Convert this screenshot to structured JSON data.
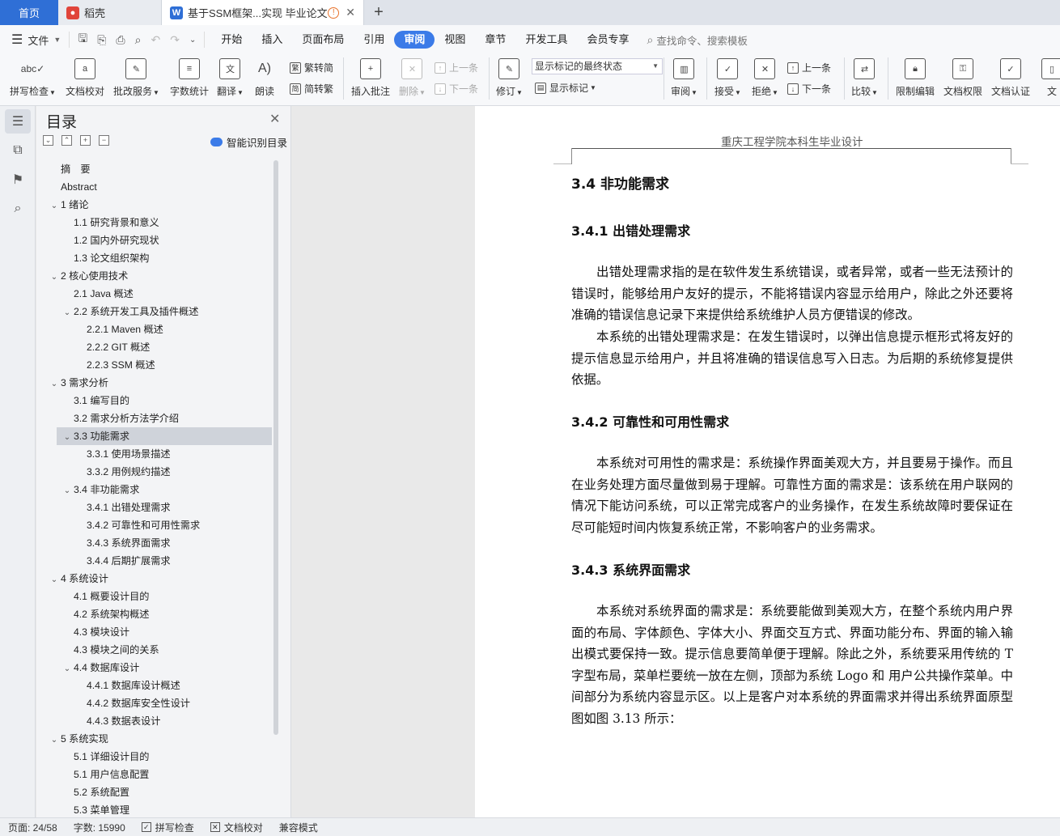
{
  "tabs": {
    "home": "首页",
    "daoke": "稻壳",
    "document": "基于SSM框架...实现 毕业论文"
  },
  "menu": {
    "file": "文件",
    "items": [
      "开始",
      "插入",
      "页面布局",
      "引用",
      "审阅",
      "视图",
      "章节",
      "开发工具",
      "会员专享"
    ],
    "active": "审阅",
    "search_placeholder": "查找命令、搜索模板"
  },
  "ribbon": {
    "spell_check": "拼写检查",
    "doc_proof": "文档校对",
    "annot_service": "批改服务",
    "word_count": "字数统计",
    "translate": "翻译",
    "read_aloud": "朗读",
    "to_traditional": "繁转简",
    "to_simplified": "简转繁",
    "insert_comment": "插入批注",
    "delete": "删除",
    "prev_comment": "上一条",
    "next_comment": "下一条",
    "track_changes": "修订",
    "markup_state": "显示标记的最终状态",
    "show_markup": "显示标记",
    "review": "审阅",
    "accept": "接受",
    "reject": "拒绝",
    "prev_change": "上一条",
    "next_change": "下一条",
    "compare": "比较",
    "restrict_edit": "限制编辑",
    "doc_rights": "文档权限",
    "doc_cert": "文档认证",
    "more": "文"
  },
  "nav": {
    "title": "目录",
    "smart_toc": "智能识别目录",
    "selected_index": 15,
    "toc": [
      {
        "level": 0,
        "text": "摘　要",
        "toggle": ""
      },
      {
        "level": 0,
        "text": "Abstract",
        "toggle": ""
      },
      {
        "level": 0,
        "text": "1  绪论",
        "toggle": "v"
      },
      {
        "level": 1,
        "text": "1.1  研究背景和意义",
        "toggle": ""
      },
      {
        "level": 1,
        "text": "1.2  国内外研究现状",
        "toggle": ""
      },
      {
        "level": 1,
        "text": "1.3  论文组织架构",
        "toggle": ""
      },
      {
        "level": 0,
        "text": "2  核心使用技术",
        "toggle": "v"
      },
      {
        "level": 1,
        "text": "2.1 Java 概述",
        "toggle": ""
      },
      {
        "level": 1,
        "text": "2.2 系统开发工具及插件概述",
        "toggle": "v"
      },
      {
        "level": 2,
        "text": "2.2.1 Maven  概述",
        "toggle": ""
      },
      {
        "level": 2,
        "text": "2.2.2 GIT 概述",
        "toggle": ""
      },
      {
        "level": 2,
        "text": "2.2.3 SSM 概述",
        "toggle": ""
      },
      {
        "level": 0,
        "text": "3  需求分析",
        "toggle": "v"
      },
      {
        "level": 1,
        "text": "3.1  编写目的",
        "toggle": ""
      },
      {
        "level": 1,
        "text": "3.2  需求分析方法学介绍",
        "toggle": ""
      },
      {
        "level": 1,
        "text": "3.3 功能需求",
        "toggle": "v"
      },
      {
        "level": 2,
        "text": "3.3.1 使用场景描述",
        "toggle": ""
      },
      {
        "level": 2,
        "text": "3.3.2 用例规约描述",
        "toggle": ""
      },
      {
        "level": 1,
        "text": "3.4  非功能需求",
        "toggle": "v"
      },
      {
        "level": 2,
        "text": "3.4.1  出错处理需求",
        "toggle": ""
      },
      {
        "level": 2,
        "text": "3.4.2  可靠性和可用性需求",
        "toggle": ""
      },
      {
        "level": 2,
        "text": "3.4.3  系统界面需求",
        "toggle": ""
      },
      {
        "level": 2,
        "text": "3.4.4  后期扩展需求",
        "toggle": ""
      },
      {
        "level": 0,
        "text": "4  系统设计",
        "toggle": "v"
      },
      {
        "level": 1,
        "text": "4.1  概要设计目的",
        "toggle": ""
      },
      {
        "level": 1,
        "text": "4.2  系统架构概述",
        "toggle": ""
      },
      {
        "level": 1,
        "text": "4.3  模块设计",
        "toggle": ""
      },
      {
        "level": 1,
        "text": "4.3  模块之间的关系",
        "toggle": ""
      },
      {
        "level": 1,
        "text": "4.4  数据库设计",
        "toggle": "v"
      },
      {
        "level": 2,
        "text": "4.4.1  数据库设计概述",
        "toggle": ""
      },
      {
        "level": 2,
        "text": "4.4.2  数据库安全性设计",
        "toggle": ""
      },
      {
        "level": 2,
        "text": "4.4.3 数据表设计",
        "toggle": ""
      },
      {
        "level": 0,
        "text": "5  系统实现",
        "toggle": "v"
      },
      {
        "level": 1,
        "text": "5.1  详细设计目的",
        "toggle": ""
      },
      {
        "level": 1,
        "text": "5.1  用户信息配置",
        "toggle": ""
      },
      {
        "level": 1,
        "text": "5.2  系统配置",
        "toggle": ""
      },
      {
        "level": 1,
        "text": "5.3  菜单管理",
        "toggle": ""
      }
    ]
  },
  "document": {
    "header": "重庆工程学院本科生毕业设计",
    "h_34": "3.4  非功能需求",
    "h_341": "3.4.1  出错处理需求",
    "p1": "出错处理需求指的是在软件发生系统错误，或者异常，或者一些无法预计的错误时，能够给用户友好的提示，不能将错误内容显示给用户，除此之外还要将准确的错误信息记录下来提供给系统维护人员方便错误的修改。",
    "p2": "本系统的出错处理需求是：在发生错误时，以弹出信息提示框形式将友好的提示信息显示给用户，并且将准确的错误信息写入日志。为后期的系统修复提供依据。",
    "h_342": "3.4.2  可靠性和可用性需求",
    "p3": "本系统对可用性的需求是：系统操作界面美观大方，并且要易于操作。而且在业务处理方面尽量做到易于理解。可靠性方面的需求是：该系统在用户联网的情况下能访问系统，可以正常完成客户的业务操作，在发生系统故障时要保证在尽可能短时间内恢复系统正常，不影响客户的业务需求。",
    "h_343": "3.4.3  系统界面需求",
    "p4": "本系统对系统界面的需求是：系统要能做到美观大方，在整个系统内用户界面的布局、字体颜色、字体大小、界面交互方式、界面功能分布、界面的输入输出模式要保持一致。提示信息要简单便于理解。除此之外，系统要采用传统的 T 字型布局，菜单栏要统一放在左侧，顶部为系统 Logo 和  用户公共操作菜单。中间部分为系统内容显示区。以上是客户对本系统的界面需求并得出系统界面原型图如图 3.13 所示："
  },
  "status": {
    "page": "页面: 24/58",
    "words": "字数: 15990",
    "spell": "拼写检查",
    "proof": "文档校对",
    "compat": "兼容模式"
  }
}
